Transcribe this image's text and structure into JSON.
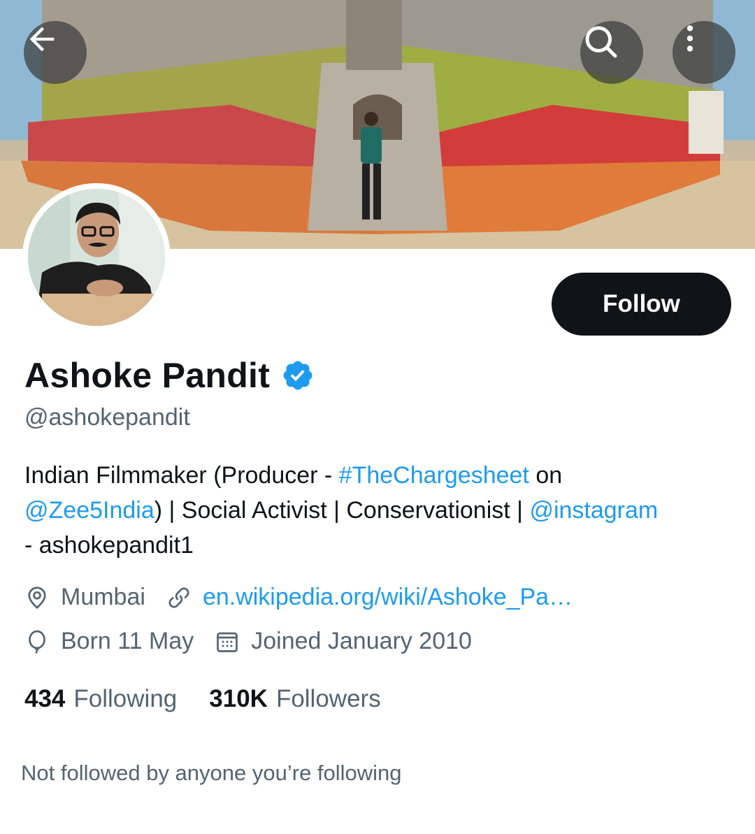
{
  "header": {
    "back_icon": "arrow-left-icon",
    "search_icon": "search-icon",
    "more_icon": "more-vertical-icon"
  },
  "profile": {
    "name": "Ashoke Pandit",
    "handle": "@ashokepandit",
    "verified": true,
    "follow_label": "Follow",
    "bio": {
      "part1": "Indian Filmmaker (Producer - ",
      "hashtag": "#TheChargesheet",
      "part2": " on ",
      "mention1": "@Zee5India",
      "part3": ") | Social Activist | Conservationist | ",
      "mention2": "@instagram",
      "part4": " - ashokepandit1"
    },
    "location": "Mumbai",
    "website": "en.wikipedia.org/wiki/Ashoke_Pa…",
    "birthday": "Born 11 May",
    "joined": "Joined January 2010",
    "following_count": "434",
    "following_label": "Following",
    "followers_count": "310K",
    "followers_label": "Followers",
    "not_followed_text": "Not followed by anyone you’re following"
  },
  "colors": {
    "accent": "#1d9bf0",
    "text_primary": "#0f1419",
    "text_secondary": "#536471",
    "button_dark": "#0f1419"
  }
}
